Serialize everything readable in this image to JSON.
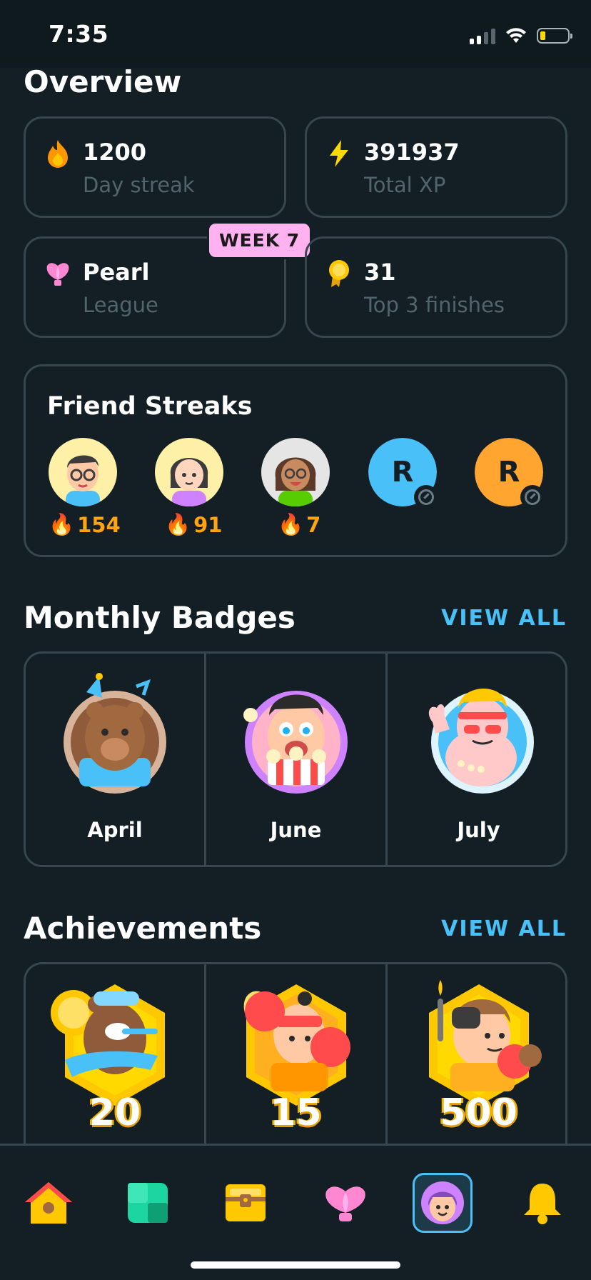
{
  "status_bar": {
    "time": "7:35"
  },
  "overview": {
    "title": "Overview",
    "stats": [
      {
        "value": "1200",
        "label": "Day streak",
        "icon": "flame-icon"
      },
      {
        "value": "391937",
        "label": "Total XP",
        "icon": "lightning-icon"
      },
      {
        "value": "Pearl",
        "label": "League",
        "icon": "pearl-league-icon",
        "badge": "WEEK 7"
      },
      {
        "value": "31",
        "label": "Top 3 finishes",
        "icon": "medal-icon"
      }
    ]
  },
  "friend_streaks": {
    "title": "Friend Streaks",
    "friends": [
      {
        "streak": "154"
      },
      {
        "streak": "91"
      },
      {
        "streak": "7"
      },
      {
        "initial": "R",
        "color": "#49c0f8"
      },
      {
        "initial": "R",
        "color": "#ffa530"
      }
    ]
  },
  "monthly_badges": {
    "title": "Monthly Badges",
    "view_all": "VIEW ALL",
    "badges": [
      {
        "label": "April"
      },
      {
        "label": "June"
      },
      {
        "label": "July"
      }
    ]
  },
  "achievements": {
    "title": "Achievements",
    "view_all": "VIEW ALL",
    "items": [
      {
        "number": "20"
      },
      {
        "number": "15"
      },
      {
        "number": "500"
      }
    ]
  },
  "tab_bar": {
    "tabs": [
      "home-icon",
      "practice-icon",
      "chest-icon",
      "leagues-icon",
      "profile-icon",
      "notifications-icon"
    ],
    "active": "profile-icon"
  },
  "colors": {
    "background": "#131f24",
    "border": "#37464f",
    "accent": "#49c0f8",
    "streak": "#ffa30f",
    "week_badge": "#ffb2ef"
  }
}
